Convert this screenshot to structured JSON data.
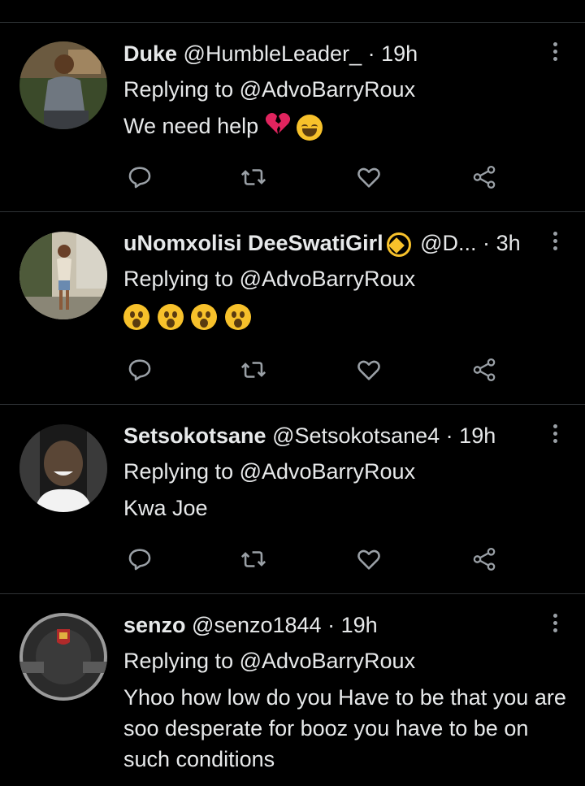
{
  "tweets": [
    {
      "name": "Duke",
      "handle": "@HumbleLeader_",
      "time": "19h",
      "replying": "Replying to @AdvoBarryRoux",
      "text": "We need help",
      "emojis": [
        "broken-heart",
        "tears-of-joy"
      ],
      "avatar_colors": [
        "#3b4a2a",
        "#8a6a4a"
      ]
    },
    {
      "name": "uNomxolisi DeeSwatiGirl",
      "handle": "@D...",
      "time": "3h",
      "replying": "Replying to @AdvoBarryRoux",
      "text": "",
      "emojis": [
        "astonished",
        "astonished",
        "astonished",
        "astonished"
      ],
      "avatar_colors": [
        "#4e5a3a",
        "#c9c2b0"
      ]
    },
    {
      "name": "Setsokotsane",
      "handle": "@Setsokotsane4",
      "time": "19h",
      "replying": "Replying to @AdvoBarryRoux",
      "text": "Kwa Joe",
      "emojis": [],
      "avatar_colors": [
        "#1a1a1a",
        "#d9d9d9"
      ]
    },
    {
      "name": "senzo",
      "handle": "@senzo1844",
      "time": "19h",
      "replying": "Replying to @AdvoBarryRoux",
      "text": "Yhoo how low do you Have to be that you are soo desperate for booz you have to be on such conditions",
      "emojis": [],
      "avatar_colors": [
        "#2b2b2b",
        "#9a9a9a"
      ]
    }
  ],
  "separator": "·",
  "icons": [
    "reply-icon",
    "retweet-icon",
    "like-icon",
    "share-icon",
    "more-options-icon"
  ],
  "colors": {
    "background": "#000000",
    "text": "#e7e9ea",
    "icon": "#9aa0a6",
    "divider": "#2f3336"
  }
}
